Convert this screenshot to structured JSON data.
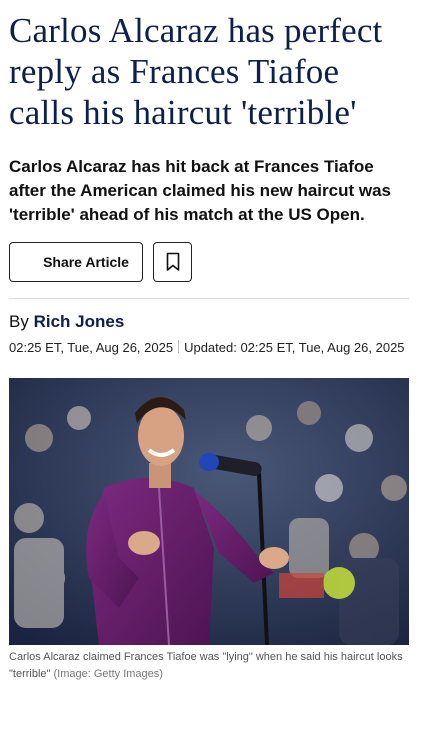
{
  "article": {
    "headline": "Carlos Alcaraz has perfect reply as Frances Tiafoe calls his haircut 'terrible'",
    "standfirst": "Carlos Alcaraz has hit back at Frances Tiafoe after the American claimed his new haircut was 'terrible' ahead of his match at the US Open."
  },
  "actions": {
    "share_label": "Share Article",
    "bookmark_icon": "bookmark-icon"
  },
  "byline": {
    "prefix": "By",
    "author": "Rich Jones",
    "published": "02:25 ET, Tue, Aug 26, 2025",
    "updated": "Updated: 02:25 ET, Tue, Aug 26, 2025"
  },
  "image": {
    "caption": "Carlos Alcaraz claimed Frances Tiafoe was \"lying\" when he said his haircut looks \"terrible\"",
    "credit": "(Image: Getty Images)"
  },
  "colors": {
    "headline": "#0d1f4d",
    "jacket": "#6b1f6e",
    "background_stands": "#1e2a4a"
  }
}
